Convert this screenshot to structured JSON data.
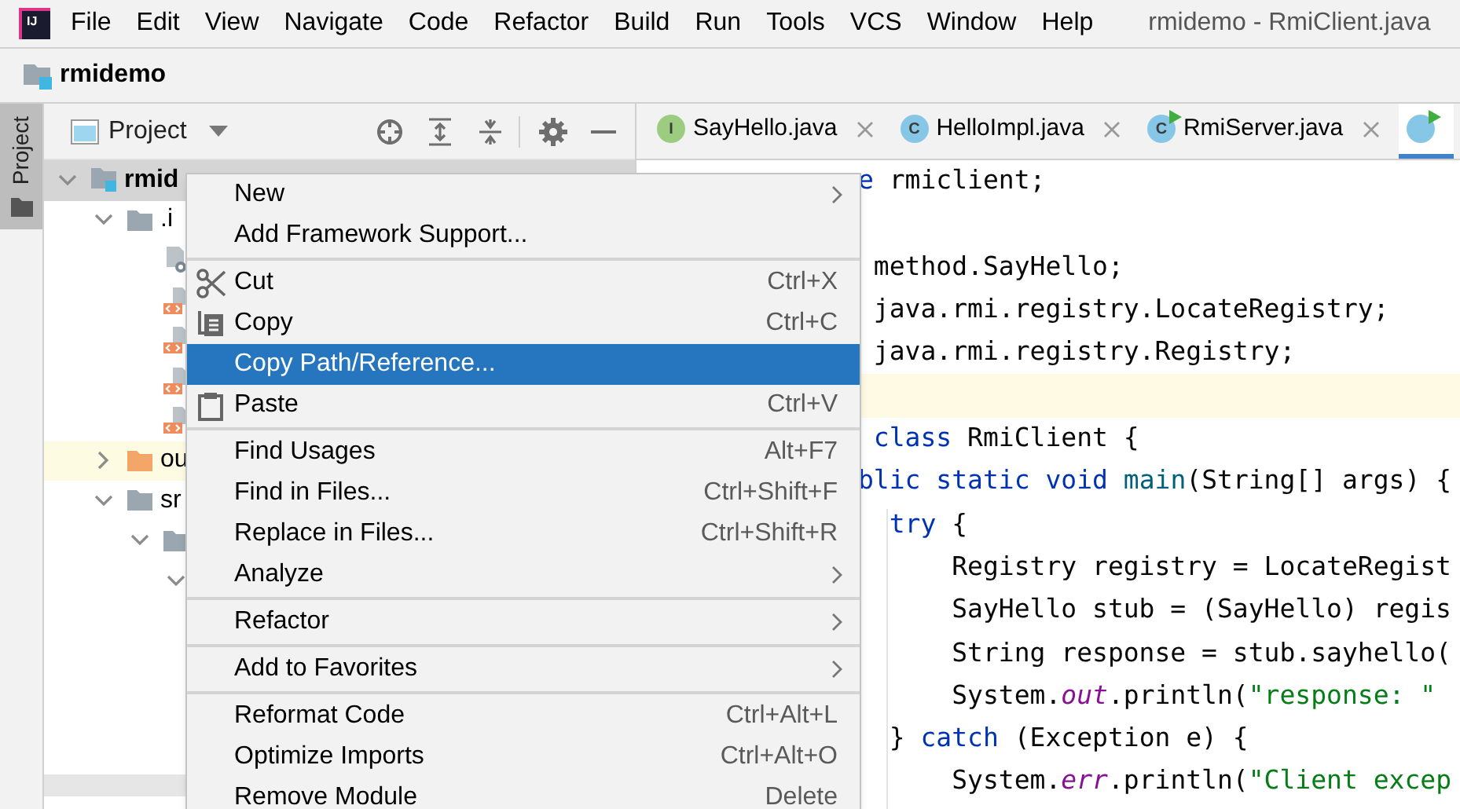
{
  "app": {
    "logo_text": "IJ",
    "title": "rmidemo - RmiClient.java"
  },
  "menu_bar": [
    {
      "label": "File"
    },
    {
      "label": "Edit"
    },
    {
      "label": "View"
    },
    {
      "label": "Navigate"
    },
    {
      "label": "Code"
    },
    {
      "label": "Refactor"
    },
    {
      "label": "Build"
    },
    {
      "label": "Run"
    },
    {
      "label": "Tools"
    },
    {
      "label": "VCS"
    },
    {
      "label": "Window"
    },
    {
      "label": "Help"
    }
  ],
  "breadcrumb": {
    "project": "rmidemo"
  },
  "tool_strip": [
    {
      "label": "Project",
      "selected": true
    }
  ],
  "project_panel": {
    "title": "Project",
    "tree": [
      {
        "kind": "module",
        "label": "rmid",
        "expanded": true,
        "selected": true,
        "highlighted": false,
        "children": [
          {
            "kind": "folder",
            "label": ".i",
            "expanded": true,
            "selected": false,
            "highlighted": false,
            "children": [
              {
                "kind": "module-file",
                "selected": false,
                "highlighted": false
              },
              {
                "kind": "xml-file",
                "selected": false,
                "highlighted": false
              },
              {
                "kind": "xml-file",
                "selected": false,
                "highlighted": false
              },
              {
                "kind": "xml-file",
                "selected": false,
                "highlighted": false
              },
              {
                "kind": "xml-file",
                "selected": false,
                "highlighted": false
              }
            ]
          },
          {
            "kind": "excluded-folder",
            "label": "ou",
            "expanded": false,
            "selected": false,
            "highlighted": true
          },
          {
            "kind": "folder",
            "label": "sr",
            "expanded": true,
            "selected": false,
            "highlighted": false,
            "children": [
              {
                "kind": "folder",
                "expanded": true,
                "selected": false,
                "highlighted": false,
                "children": [
                  {
                    "expanded": true,
                    "selected": false,
                    "highlighted": false
                  }
                ]
              }
            ]
          }
        ]
      }
    ]
  },
  "editor_tabs": [
    {
      "kind": "interface",
      "badge": "I",
      "label": "SayHello.java",
      "selected": false
    },
    {
      "kind": "class",
      "badge": "C",
      "label": "HelloImpl.java",
      "selected": false
    },
    {
      "kind": "runnable-class",
      "badge": "C",
      "label": "RmiServer.java",
      "selected": false
    },
    {
      "kind": "runnable-class",
      "selected": true
    }
  ],
  "code_lines": [
    {
      "current": false,
      "tokens": [
        {
          "kind": "keyword",
          "t": "e"
        },
        {
          "kind": "plain",
          "t": " rmiclient;"
        }
      ]
    },
    {
      "current": false
    },
    {
      "current": false,
      "tokens": [
        {
          "kind": "plain",
          "t": " method.SayHello;"
        }
      ]
    },
    {
      "current": false,
      "tokens": [
        {
          "kind": "plain",
          "t": " java.rmi.registry.LocateRegistry;"
        }
      ]
    },
    {
      "current": false,
      "tokens": [
        {
          "kind": "plain",
          "t": " java.rmi.registry.Registry;"
        }
      ]
    },
    {
      "current": true
    },
    {
      "current": false,
      "tokens": [
        {
          "kind": "keyword",
          "t": " class"
        },
        {
          "kind": "plain",
          "t": " RmiClient {"
        }
      ]
    },
    {
      "current": false,
      "tokens": [
        {
          "kind": "keyword",
          "t": "blic static void "
        },
        {
          "kind": "method",
          "t": "main"
        },
        {
          "kind": "plain",
          "t": "(String[] args) {"
        }
      ]
    },
    {
      "current": false,
      "tokens": [
        {
          "kind": "keyword",
          "t": "  try"
        },
        {
          "kind": "plain",
          "t": " {"
        }
      ]
    },
    {
      "current": false,
      "tokens": [
        {
          "kind": "plain",
          "t": "      Registry registry = LocateRegist"
        }
      ]
    },
    {
      "current": false,
      "tokens": [
        {
          "kind": "plain",
          "t": "      SayHello stub = (SayHello) regis"
        }
      ]
    },
    {
      "current": false,
      "tokens": [
        {
          "kind": "plain",
          "t": "      String response = stub.sayhello("
        }
      ]
    },
    {
      "current": false,
      "tokens": [
        {
          "kind": "plain",
          "t": "      System."
        },
        {
          "kind": "field",
          "t": "out"
        },
        {
          "kind": "plain",
          "t": ".println("
        },
        {
          "kind": "string",
          "t": "\"response: \""
        }
      ]
    },
    {
      "current": false,
      "tokens": [
        {
          "kind": "plain",
          "t": "  } "
        },
        {
          "kind": "keyword",
          "t": "catch"
        },
        {
          "kind": "plain",
          "t": " (Exception e) {"
        }
      ]
    },
    {
      "current": false,
      "tokens": [
        {
          "kind": "plain",
          "t": "      System."
        },
        {
          "kind": "field",
          "t": "err"
        },
        {
          "kind": "plain",
          "t": ".println("
        },
        {
          "kind": "string",
          "t": "\"Client excep"
        }
      ]
    }
  ],
  "context_menu": [
    [
      {
        "label": "New",
        "submenu": true,
        "selected": false
      },
      {
        "label": "Add Framework Support...",
        "selected": false
      }
    ],
    [
      {
        "kind": "cut",
        "label": "Cut",
        "shortcut": "Ctrl+X",
        "selected": false
      },
      {
        "kind": "copy",
        "label": "Copy",
        "shortcut": "Ctrl+C",
        "selected": false
      },
      {
        "label": "Copy Path/Reference...",
        "selected": true
      },
      {
        "kind": "paste",
        "label": "Paste",
        "shortcut": "Ctrl+V",
        "selected": false
      }
    ],
    [
      {
        "label": "Find Usages",
        "shortcut": "Alt+F7",
        "selected": false
      },
      {
        "label": "Find in Files...",
        "shortcut": "Ctrl+Shift+F",
        "selected": false
      },
      {
        "label": "Replace in Files...",
        "shortcut": "Ctrl+Shift+R",
        "selected": false
      },
      {
        "label": "Analyze",
        "submenu": true,
        "selected": false
      }
    ],
    [
      {
        "label": "Refactor",
        "submenu": true,
        "selected": false
      }
    ],
    [
      {
        "label": "Add to Favorites",
        "submenu": true,
        "selected": false
      }
    ],
    [
      {
        "label": "Reformat Code",
        "shortcut": "Ctrl+Alt+L",
        "selected": false
      },
      {
        "label": "Optimize Imports",
        "shortcut": "Ctrl+Alt+O",
        "selected": false
      },
      {
        "label": "Remove Module",
        "shortcut": "Delete",
        "selected": false
      }
    ]
  ]
}
